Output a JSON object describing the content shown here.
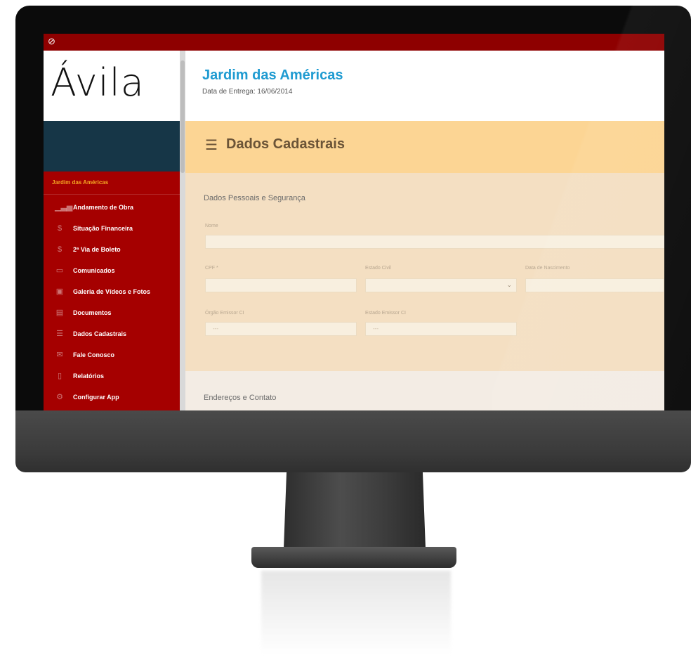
{
  "app": {
    "logo": "Ávila"
  },
  "sidebar": {
    "section_label": "Jardim das Américas",
    "items": [
      {
        "label": "Andamento de Obra",
        "icon": "bar-chart-icon"
      },
      {
        "label": "Situação Financeira",
        "icon": "money-icon"
      },
      {
        "label": "2ª Via de Boleto",
        "icon": "barcode-icon"
      },
      {
        "label": "Comunicados",
        "icon": "chat-icon"
      },
      {
        "label": "Galeria de Vídeos e Fotos",
        "icon": "gallery-icon"
      },
      {
        "label": "Documentos",
        "icon": "document-icon"
      },
      {
        "label": "Dados Cadastrais",
        "icon": "list-icon"
      },
      {
        "label": "Fale Conosco",
        "icon": "envelope-icon"
      },
      {
        "label": "Relatórios",
        "icon": "report-icon"
      },
      {
        "label": "Configurar App",
        "icon": "gear-icon"
      }
    ]
  },
  "header": {
    "project_title": "Jardim das Américas",
    "delivery_date": "Data de Entrega: 16/06/2014"
  },
  "banner": {
    "title": "Dados Cadastrais"
  },
  "form": {
    "section_personal": "Dados Pessoais e Segurança",
    "nome_label": "Nome",
    "cpf_label": "CPF *",
    "estado_civil_label": "Estado Civil",
    "data_nascimento_label": "Data de Nascimento",
    "orgao_emissor_label": "Órgão Emissor CI",
    "estado_emissor_label": "Estado Emissor CI",
    "orgao_emissor_value": "---",
    "estado_emissor_value": "---",
    "section_address": "Endereços e Contato"
  },
  "colors": {
    "topbar": "#8e0000",
    "sidebar": "#a50000",
    "navy": "#163647",
    "title_blue": "#1f9bd1",
    "banner": "#fcd594",
    "section": "#f4dfc2"
  }
}
